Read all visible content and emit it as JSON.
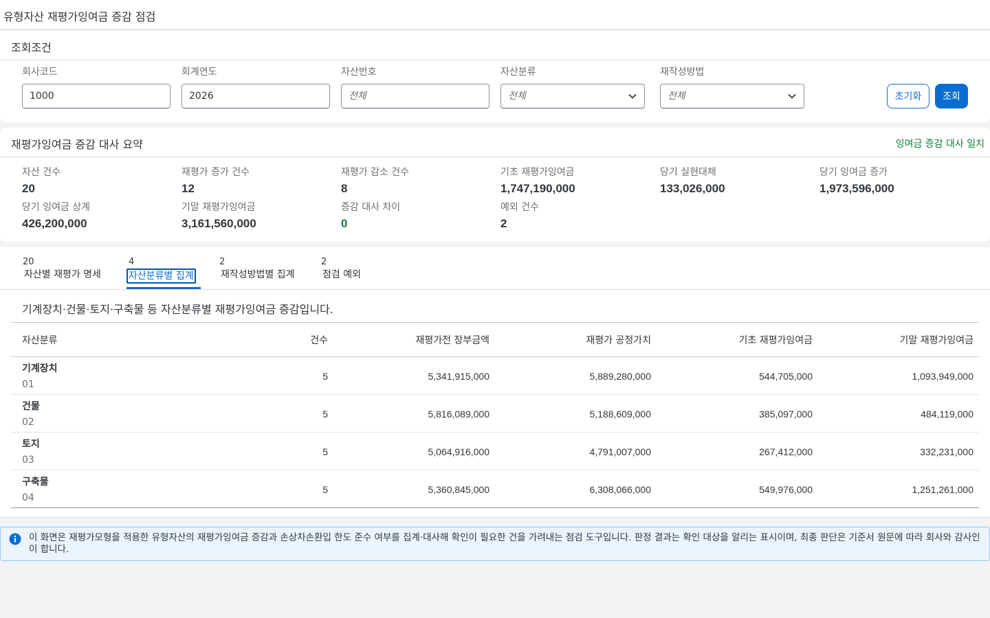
{
  "app": {
    "title": "유형자산 재평가잉여금 증감 점검"
  },
  "filters": {
    "title": "조회조건",
    "company_code": {
      "label": "회사코드",
      "value": "1000"
    },
    "fiscal_year": {
      "label": "회계연도",
      "value": "2026"
    },
    "asset_number": {
      "label": "자산번호",
      "placeholder": "전체"
    },
    "asset_class": {
      "label": "자산분류",
      "value": "전체"
    },
    "method": {
      "label": "재작성방법",
      "value": "전체"
    },
    "reset_label": "초기화",
    "search_label": "조회"
  },
  "summary": {
    "title": "재평가잉여금 증감 대사 요약",
    "status": "잉여금 증감 대사 일치",
    "kpis": [
      {
        "label": "자산 건수",
        "value": "20"
      },
      {
        "label": "재평가 증가 건수",
        "value": "12"
      },
      {
        "label": "재평가 감소 건수",
        "value": "8"
      },
      {
        "label": "기초 재평가잉여금",
        "value": "1,747,190,000"
      },
      {
        "label": "당기 실현대체",
        "value": "133,026,000"
      },
      {
        "label": "당기 잉여금 증가",
        "value": "1,973,596,000"
      },
      {
        "label": "당기 잉여금 상계",
        "value": "426,200,000"
      },
      {
        "label": "기말 재평가잉여금",
        "value": "3,161,560,000"
      },
      {
        "label": "증감 대사 차이",
        "value": "0"
      },
      {
        "label": "예외 건수",
        "value": "2"
      }
    ]
  },
  "tabs": [
    {
      "count": "20",
      "label": "자산별 재평가 명세"
    },
    {
      "count": "4",
      "label": "자산분류별 집계"
    },
    {
      "count": "2",
      "label": "재작성방법별 집계"
    },
    {
      "count": "2",
      "label": "점검 예외"
    }
  ],
  "content": {
    "description": "기계장치·건물·토지·구축물 등 자산분류별 재평가잉여금 증감입니다.",
    "columns": [
      "자산분류",
      "건수",
      "재평가전 장부금액",
      "재평가 공정가치",
      "기초 재평가잉여금",
      "기말 재평가잉여금"
    ],
    "rows": [
      {
        "name": "기계장치",
        "code": "01",
        "count": "5",
        "book": "5,341,915,000",
        "fair": "5,889,280,000",
        "open": "544,705,000",
        "close": "1,093,949,000"
      },
      {
        "name": "건물",
        "code": "02",
        "count": "5",
        "book": "5,816,089,000",
        "fair": "5,188,609,000",
        "open": "385,097,000",
        "close": "484,119,000"
      },
      {
        "name": "토지",
        "code": "03",
        "count": "5",
        "book": "5,064,916,000",
        "fair": "4,791,007,000",
        "open": "267,412,000",
        "close": "332,231,000"
      },
      {
        "name": "구축물",
        "code": "04",
        "count": "5",
        "book": "5,360,845,000",
        "fair": "6,308,066,000",
        "open": "549,976,000",
        "close": "1,251,261,000"
      }
    ]
  },
  "info": {
    "text": "이 화면은 재평가모형을 적용한 유형자산의 재평가잉여금 증감과 손상차손환입 한도 준수 여부를 집계·대사해 확인이 필요한 건을 가려내는 점검 도구입니다. 판정 결과는 확인 대상을 알리는 표시이며, 최종 판단은 기준서 원문에 따라 회사와 감사인이 합니다."
  },
  "colors": {
    "accent": "#0a6ed1",
    "success": "#107e3e"
  },
  "icons": {
    "select": "chevron-down-icon",
    "info": "info-icon"
  }
}
